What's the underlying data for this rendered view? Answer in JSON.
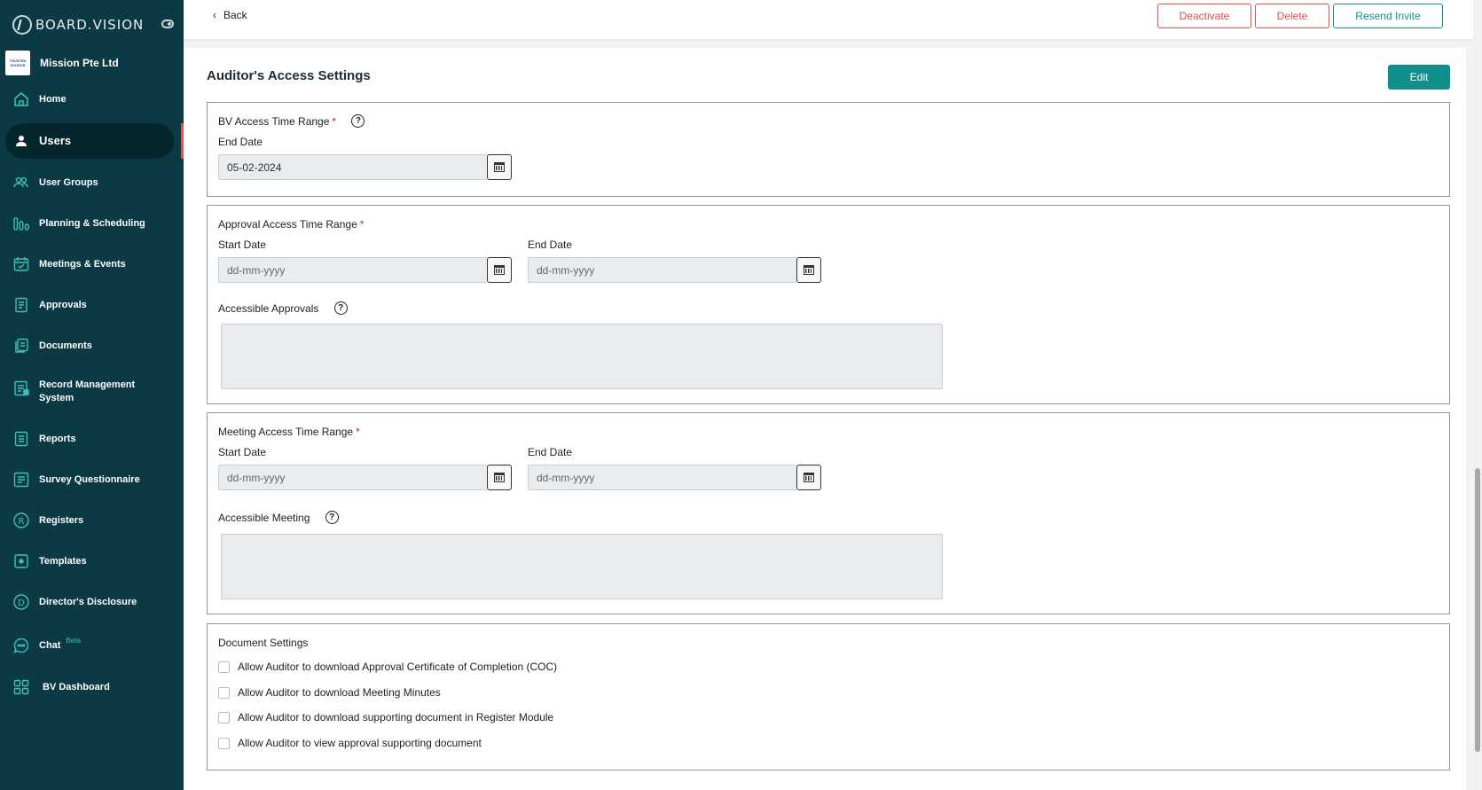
{
  "app": {
    "logo_text": "BOARD.VISION",
    "org_name": "Mission Pte Ltd",
    "org_logo_text": "TRUSTED SOURCE"
  },
  "sidebar": {
    "items": [
      {
        "label": "Home",
        "icon": "home-icon"
      },
      {
        "label": "Users",
        "icon": "user-icon",
        "active": true
      },
      {
        "label": "User Groups",
        "icon": "user-groups-icon"
      },
      {
        "label": "Planning & Scheduling",
        "icon": "planning-icon"
      },
      {
        "label": "Meetings & Events",
        "icon": "calendar-check-icon"
      },
      {
        "label": "Approvals",
        "icon": "approvals-icon"
      },
      {
        "label": "Documents",
        "icon": "documents-icon"
      },
      {
        "label": "Record Management System",
        "icon": "record-management-icon"
      },
      {
        "label": "Reports",
        "icon": "reports-icon"
      },
      {
        "label": "Survey Questionnaire",
        "icon": "survey-icon"
      },
      {
        "label": "Registers",
        "icon": "registers-icon"
      },
      {
        "label": "Templates",
        "icon": "templates-icon"
      },
      {
        "label": "Director's Disclosure",
        "icon": "disclosure-icon"
      },
      {
        "label": "Chat",
        "icon": "chat-icon",
        "badge": "Beta"
      },
      {
        "label": "BV Dashboard",
        "icon": "dashboard-icon"
      }
    ]
  },
  "toolbar": {
    "back_label": "Back",
    "deactivate_label": "Deactivate",
    "delete_label": "Delete",
    "resend_label": "Resend Invite"
  },
  "main": {
    "title": "Auditor's Access Settings",
    "edit_label": "Edit",
    "bv_access": {
      "title": "BV Access Time Range",
      "required": "*",
      "end_label": "End Date",
      "end_value": "05-02-2024"
    },
    "approval_access": {
      "title": "Approval Access Time Range",
      "required": "*",
      "start_label": "Start Date",
      "start_placeholder": "dd-mm-yyyy",
      "end_label": "End Date",
      "end_placeholder": "dd-mm-yyyy",
      "accessible_label": "Accessible Approvals"
    },
    "meeting_access": {
      "title": "Meeting Access Time Range",
      "required": "*",
      "start_label": "Start Date",
      "start_placeholder": "dd-mm-yyyy",
      "end_label": "End Date",
      "end_placeholder": "dd-mm-yyyy",
      "accessible_label": "Accessible Meeting"
    },
    "document_settings": {
      "title": "Document Settings",
      "options": [
        {
          "label": "Allow Auditor to download Approval Certificate of Completion (COC)",
          "checked": false
        },
        {
          "label": "Allow Auditor to download Meeting Minutes",
          "checked": false
        },
        {
          "label": "Allow Auditor to download supporting document in Register Module",
          "checked": false
        },
        {
          "label": "Allow Auditor to view approval supporting document",
          "checked": false
        }
      ]
    }
  },
  "colors": {
    "sidebar_bg": "#0b3a44",
    "accent_teal": "#108f8d",
    "danger": "#e05050",
    "icon_teal": "#3ec1b4"
  }
}
